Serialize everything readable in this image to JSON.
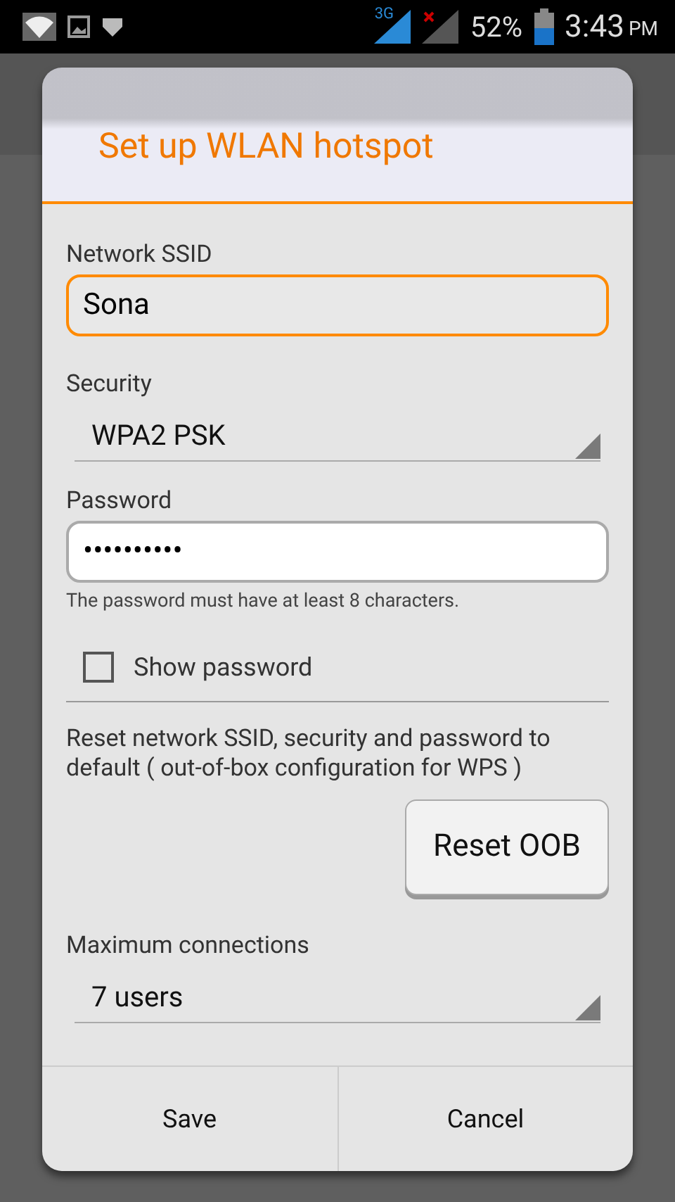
{
  "status_bar": {
    "network_type": "3G",
    "battery": "52%",
    "time": "3:43",
    "ampm": "PM"
  },
  "dialog": {
    "title": "Set up WLAN hotspot",
    "ssid": {
      "label": "Network SSID",
      "value": "Sona",
      "focused": true
    },
    "security": {
      "label": "Security",
      "value": "WPA2 PSK"
    },
    "password": {
      "label": "Password",
      "value": "••••••••••",
      "hint": "The password must have at least 8 characters."
    },
    "show_password": {
      "label": "Show password",
      "checked": false
    },
    "reset": {
      "text": "Reset network SSID, security and password to default ( out-of-box configuration for WPS )",
      "button": "Reset OOB"
    },
    "max_connections": {
      "label": "Maximum connections",
      "value": "7 users"
    },
    "buttons": [
      "Save",
      "Cancel"
    ]
  }
}
